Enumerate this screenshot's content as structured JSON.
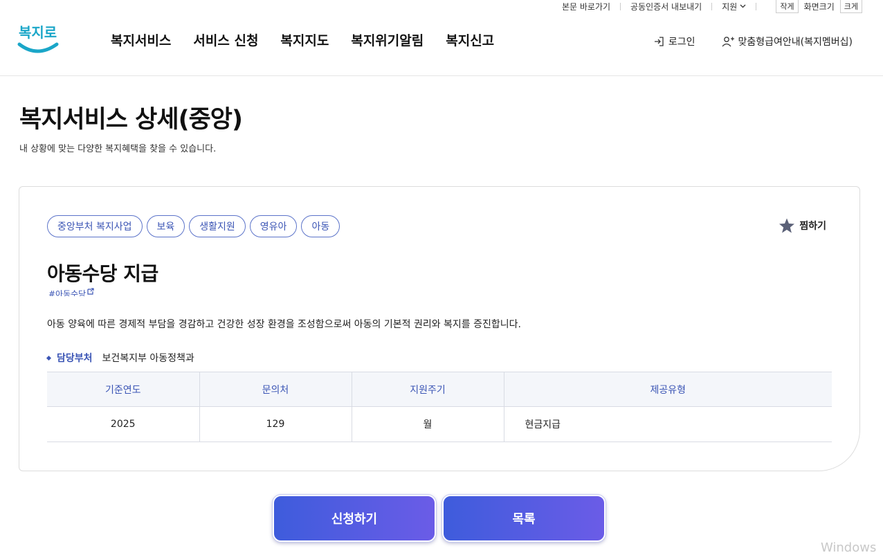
{
  "utility": {
    "skip_to_content": "본문 바로가기",
    "export_cert": "공동인증서 내보내기",
    "support": "지원",
    "font_small": "작게",
    "font_label": "화면크기",
    "font_large": "크게"
  },
  "logo": {
    "text": "복지로"
  },
  "nav": [
    "복지서비스",
    "서비스 신청",
    "복지지도",
    "복지위기알림",
    "복지신고"
  ],
  "header_right": {
    "login": "로그인",
    "membership": "맞춤형급여안내(복지멤버십)"
  },
  "page": {
    "title": "복지서비스 상세(중앙)",
    "subtitle": "내 상황에 맞는 다양한 복지혜택을 찾을 수 있습니다."
  },
  "service": {
    "tags": [
      "중앙부처 복지사업",
      "보육",
      "생활지원",
      "영유아",
      "아동"
    ],
    "favorite_label": "찜하기",
    "name": "아동수당 지급",
    "hashtag": "#아동수당",
    "description": "아동 양육에 따른 경제적 부담을 경감하고 건강한 성장 환경을 조성함으로써 아동의 기본적 권리와 복지를 증진합니다.",
    "dept_label": "담당부처",
    "dept_value": "보건복지부 아동정책과",
    "table": {
      "headers": [
        "기준연도",
        "문의처",
        "지원주기",
        "제공유형"
      ],
      "row": [
        "2025",
        "129",
        "월",
        "현금지급"
      ]
    }
  },
  "buttons": {
    "apply": "신청하기",
    "list": "목록"
  },
  "watermark": "Windows",
  "colors": {
    "accent": "#3b55b5",
    "button_start": "#3e5cdc",
    "button_end": "#6b5ce7"
  }
}
